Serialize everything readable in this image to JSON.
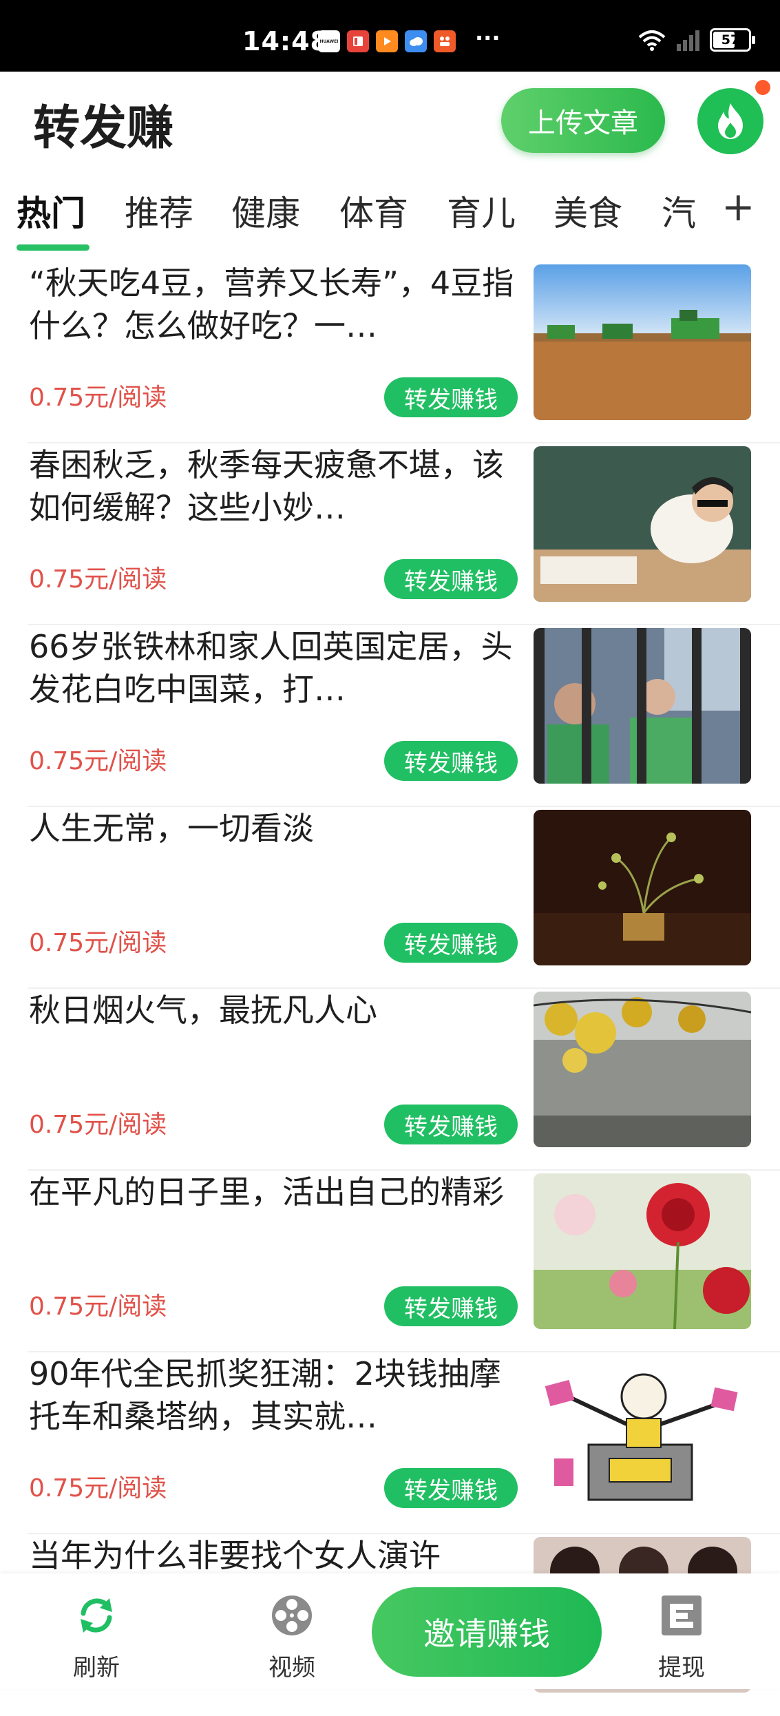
{
  "status_bar": {
    "time": "14:48",
    "apps": [
      {
        "icon": "huawei-icon",
        "label": "HUAWEI",
        "color": "#ffffff"
      },
      {
        "icon": "red-book-icon",
        "label": "",
        "color": "#e8433b"
      },
      {
        "icon": "play-icon",
        "label": "",
        "color": "#ff8a1f"
      },
      {
        "icon": "cloud-icon",
        "label": "",
        "color": "#3d8ef0"
      },
      {
        "icon": "grid-app-icon",
        "label": "",
        "color": "#f05a28"
      }
    ],
    "more": "···",
    "battery": "57"
  },
  "header": {
    "title": "转发赚",
    "upload_label": "上传文章",
    "hot_icon": "flame-icon"
  },
  "tabs": [
    "热门",
    "推荐",
    "健康",
    "体育",
    "育儿",
    "美食",
    "汽"
  ],
  "tab_plus": "+",
  "articles": [
    {
      "title": "“秋天吃4豆，营养又长寿”，4豆指什么？怎么做好吃？一…",
      "price": "0.75元/阅读",
      "action": "转发赚钱",
      "image": "harvest-field"
    },
    {
      "title": "春困秋乏，秋季每天疲惫不堪，该如何缓解？这些小妙…",
      "price": "0.75元/阅读",
      "action": "转发赚钱",
      "image": "student-sleeping"
    },
    {
      "title": "66岁张铁林和家人回英国定居，头发花白吃中国菜，打…",
      "price": "0.75元/阅读",
      "action": "转发赚钱",
      "image": "restaurant-window"
    },
    {
      "title": "人生无常，一切看淡",
      "price": "0.75元/阅读",
      "action": "转发赚钱",
      "image": "ikebana"
    },
    {
      "title": "秋日烟火气，最抚凡人心",
      "price": "0.75元/阅读",
      "action": "转发赚钱",
      "image": "autumn-wall"
    },
    {
      "title": "在平凡的日子里，活出自己的精彩",
      "price": "0.75元/阅读",
      "action": "转发赚钱",
      "image": "red-roses"
    },
    {
      "title": "90年代全民抓奖狂潮：2块钱抽摩托车和桑塔纳，其实就…",
      "price": "0.75元/阅读",
      "action": "转发赚钱",
      "image": "lottery-cartoon"
    },
    {
      "title": "当年为什么非要找个女人演许",
      "price": "",
      "action": "",
      "image": "people-portraits"
    }
  ],
  "bottom_nav": {
    "refresh": "刷新",
    "video": "视频",
    "invite": "邀请赚钱",
    "withdraw": "提现"
  },
  "colors": {
    "accent": "#21bf63",
    "price": "#e0524a"
  }
}
